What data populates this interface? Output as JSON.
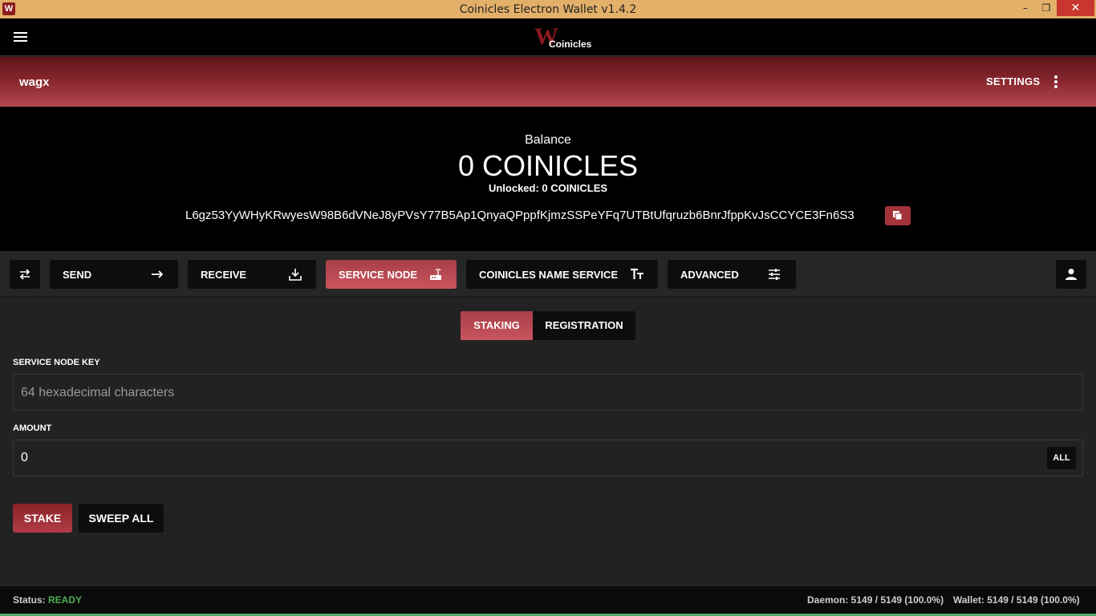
{
  "window": {
    "title": "Coinicles Electron Wallet v1.4.2",
    "minimize": "–",
    "maximize": "❐",
    "close": "✕"
  },
  "header": {
    "brand_name": "Coinicles",
    "brand_letter": "W"
  },
  "walletbar": {
    "wallet_name": "wagx",
    "settings_label": "SETTINGS"
  },
  "balance": {
    "label": "Balance",
    "value": "0 COINICLES",
    "unlocked": "Unlocked: 0 COINICLES",
    "address": "L6gz53YyWHyKRwyesW98B6dVNeJ8yPVsY77B5Ap1QnyaQPppfKjmzSSPeYFq7UTBtUfqruzb6BnrJfppKvJsCCYCE3Fn6S3"
  },
  "nav": {
    "send": "SEND",
    "receive": "RECEIVE",
    "service_node": "SERVICE NODE",
    "name_service": "COINICLES NAME SERVICE",
    "advanced": "ADVANCED"
  },
  "main": {
    "tabs": {
      "staking": "STAKING",
      "registration": "REGISTRATION"
    },
    "key_label": "SERVICE NODE KEY",
    "key_placeholder": "64 hexadecimal characters",
    "amount_label": "AMOUNT",
    "amount_value": "0",
    "all_label": "ALL",
    "stake_label": "STAKE",
    "sweep_label": "SWEEP ALL"
  },
  "status": {
    "status_prefix": "Status:",
    "status_value": "READY",
    "daemon": "Daemon: 5149 / 5149 (100.0%)",
    "wallet": "Wallet: 5149 / 5149 (100.0%)"
  },
  "colors": {
    "accent": "#a83e47",
    "ready": "#4caf50",
    "titlebar": "#e3b069"
  }
}
